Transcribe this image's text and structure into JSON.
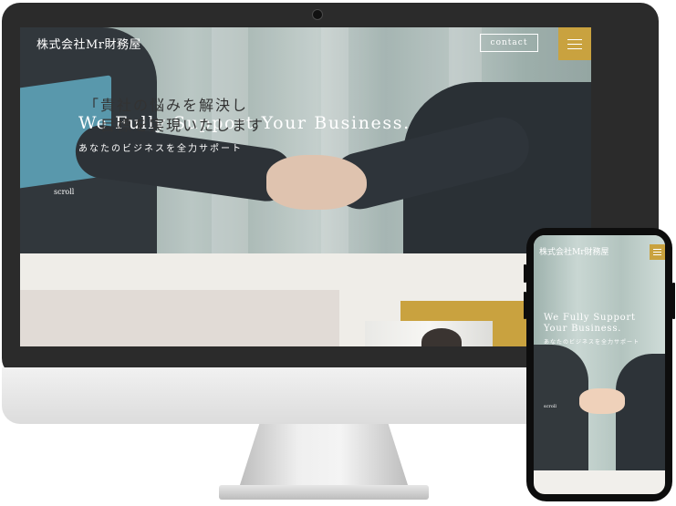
{
  "desktop": {
    "header": {
      "logo": "株式会社Mr財務屋",
      "contact_label": "contact"
    },
    "hero": {
      "title": "We Fully Support Your Business.",
      "subtitle": "あなたのビジネスを全力サポート",
      "scroll_label": "scroll"
    },
    "section2": {
      "heading_line1": "「貴社の悩みを解決し",
      "heading_line2": "目標を実現いたします"
    }
  },
  "mobile": {
    "header": {
      "logo": "株式会社Mr財務屋"
    },
    "hero": {
      "title": "We Fully Support Your Business.",
      "subtitle": "あなたのビジネスを全力サポート",
      "scroll_label": "scroll"
    }
  },
  "colors": {
    "accent_gold": "#c9a23f",
    "device_frame": "#2b2b2b",
    "section_bg": "#efede8"
  },
  "icons": {
    "menu": "hamburger-menu-icon"
  }
}
